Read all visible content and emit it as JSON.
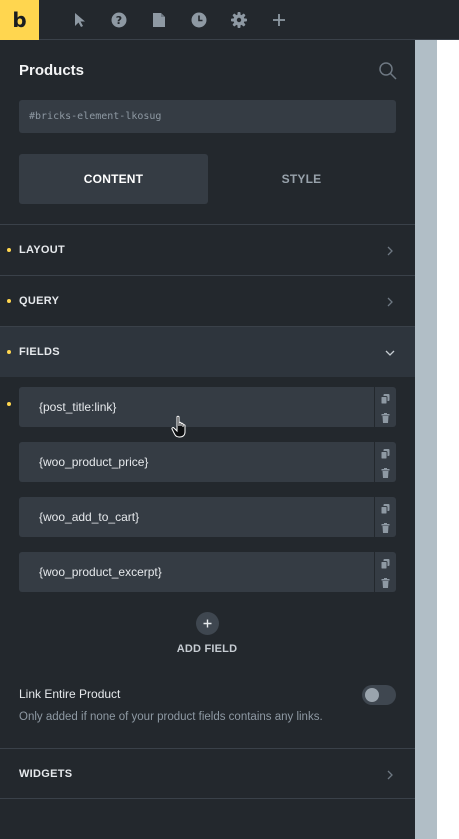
{
  "toolbar": {
    "logo_letter": "b",
    "icons": [
      "pointer-icon",
      "help-icon",
      "pages-icon",
      "history-icon",
      "settings-icon",
      "add-icon"
    ]
  },
  "panel": {
    "title": "Products",
    "element_id": "#bricks-element-lkosug",
    "tabs": [
      {
        "label": "CONTENT",
        "active": true
      },
      {
        "label": "STYLE",
        "active": false
      }
    ]
  },
  "sections": {
    "layout": {
      "label": "LAYOUT"
    },
    "query": {
      "label": "QUERY"
    },
    "fields": {
      "label": "FIELDS"
    },
    "widgets": {
      "label": "WIDGETS"
    }
  },
  "fields": [
    {
      "value": "{post_title:link}"
    },
    {
      "value": "{woo_product_price}"
    },
    {
      "value": "{woo_add_to_cart}"
    },
    {
      "value": "{woo_product_excerpt}"
    }
  ],
  "add_field": {
    "label": "ADD FIELD"
  },
  "link_entire_product": {
    "label": "Link Entire Product",
    "enabled": false,
    "description": "Only added if none of your product fields contains any links."
  },
  "colors": {
    "accent": "#ffd64f",
    "panel_bg": "#23282d",
    "input_bg": "#353c44"
  }
}
